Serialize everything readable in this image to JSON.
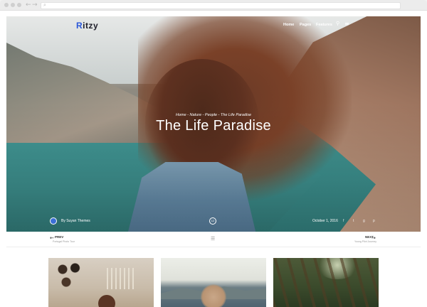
{
  "site": {
    "logo_mark": "R",
    "logo_rest": "itzy",
    "nav": [
      {
        "label": "Home"
      },
      {
        "label": "Pages"
      },
      {
        "label": "Features"
      }
    ]
  },
  "hero": {
    "breadcrumb": "Home - Nature - People - The Life Paradise",
    "title": "The Life Paradise",
    "author": "By Suyan Themes",
    "date": "October 1, 2016",
    "comments": "12",
    "share_icons": [
      "f",
      "t",
      "g",
      "p"
    ]
  },
  "post_nav": {
    "prev_label": "PREV",
    "prev_title": "Portugal  Photo Tour",
    "next_label": "NEXT",
    "next_title": "Young Pilot Journey"
  },
  "icons": {
    "search": "search-icon",
    "menu": "hamburger-icon",
    "grid": "grid-icon",
    "prev": "arrow-left-icon",
    "next": "arrow-right-icon"
  },
  "colors": {
    "brand_blue": "#2a57d8",
    "lake": "#3a8a88",
    "hair": "#7a4128"
  }
}
